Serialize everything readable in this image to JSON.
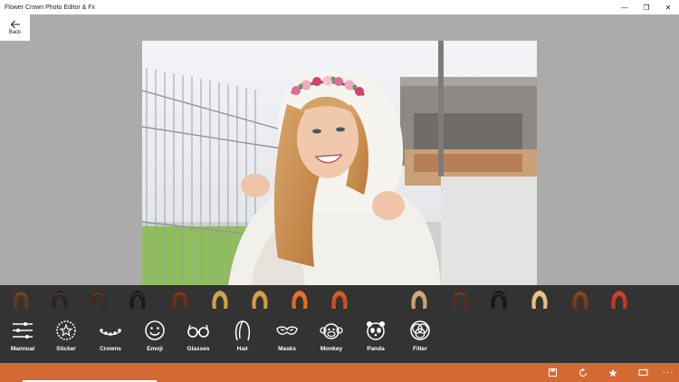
{
  "window": {
    "title": "Flower Crown Photo Editor & Fx",
    "controls": {
      "minimize": "—",
      "restore": "❐",
      "close": "✕"
    }
  },
  "back": {
    "label": "Back",
    "icon": "arrow-left-icon"
  },
  "colors": {
    "background": "#ababab",
    "panel": "#333333",
    "accent": "#d46a33"
  },
  "hair_options": [
    {
      "icon": "hair-brown-long-icon",
      "color": "#5a3a22"
    },
    {
      "icon": "hair-dark-long-icon",
      "color": "#2a2320"
    },
    {
      "icon": "hair-dark-brown-icon",
      "color": "#3e2a1c"
    },
    {
      "icon": "hair-black-icon",
      "color": "#1d1a18"
    },
    {
      "icon": "hair-auburn-bob-icon",
      "color": "#6a2c12"
    },
    {
      "icon": "hair-blonde-icon",
      "color": "#c9a24a"
    },
    {
      "icon": "hair-golden-icon",
      "color": "#d29a3a"
    },
    {
      "icon": "hair-orange-icon",
      "color": "#e36b1e"
    },
    {
      "icon": "hair-copper-curly-icon",
      "color": "#c9531e"
    },
    {
      "icon": "hair-ash-blonde-icon",
      "color": "#c6a671"
    },
    {
      "icon": "hair-dark-brown-short-icon",
      "color": "#4b3022"
    },
    {
      "icon": "hair-black-short-icon",
      "color": "#191716"
    },
    {
      "icon": "hair-platinum-icon",
      "color": "#e0c27a"
    },
    {
      "icon": "hair-auburn-icon",
      "color": "#7a3a1a"
    },
    {
      "icon": "hair-red-icon",
      "color": "#c23a1e"
    }
  ],
  "tools": [
    {
      "label": "Mannual",
      "icon": "sliders-icon"
    },
    {
      "label": "Sticker",
      "icon": "sticker-star-icon"
    },
    {
      "label": "Crowns",
      "icon": "crown-icon"
    },
    {
      "label": "Emoji",
      "icon": "emoji-icon"
    },
    {
      "label": "Glasses",
      "icon": "glasses-icon"
    },
    {
      "label": "Hair",
      "icon": "hair-icon"
    },
    {
      "label": "Masks",
      "icon": "mask-icon"
    },
    {
      "label": "Monkey",
      "icon": "monkey-icon"
    },
    {
      "label": "Panda",
      "icon": "panda-icon"
    },
    {
      "label": "Filter",
      "icon": "filter-icon"
    }
  ],
  "commands": [
    {
      "icon": "save-icon"
    },
    {
      "icon": "reset-icon"
    },
    {
      "icon": "rate-star-icon"
    },
    {
      "icon": "rotate-icon"
    },
    {
      "icon": "more-icon",
      "glyph": "···"
    }
  ]
}
